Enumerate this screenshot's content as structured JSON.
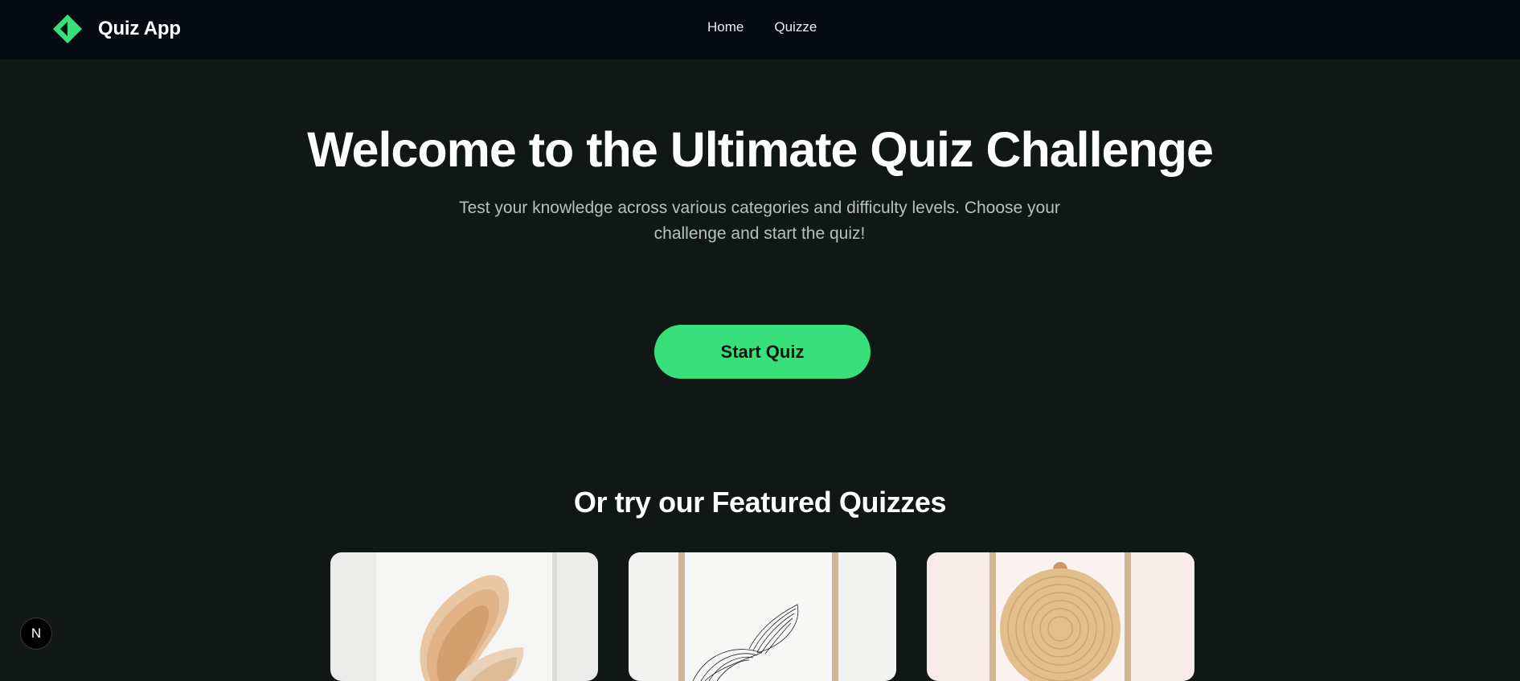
{
  "header": {
    "app_name": "Quiz App",
    "logo_icon": "diamond-logo-icon",
    "nav": [
      {
        "label": "Home"
      },
      {
        "label": "Quizze"
      }
    ]
  },
  "hero": {
    "title": "Welcome to the Ultimate Quiz Challenge",
    "subtitle": "Test your knowledge across various categories and difficulty levels. Choose your challenge and start the quiz!",
    "cta_label": "Start Quiz"
  },
  "featured": {
    "title": "Or try our Featured Quizzes",
    "cards": [
      {
        "image": "abstract-wood-shape-art"
      },
      {
        "image": "line-art-leaf-print"
      },
      {
        "image": "wood-circle-art"
      }
    ]
  },
  "dev_badge": {
    "label": "N"
  },
  "colors": {
    "accent": "#38e07b",
    "background": "#111714",
    "header_bg": "#060b12"
  }
}
